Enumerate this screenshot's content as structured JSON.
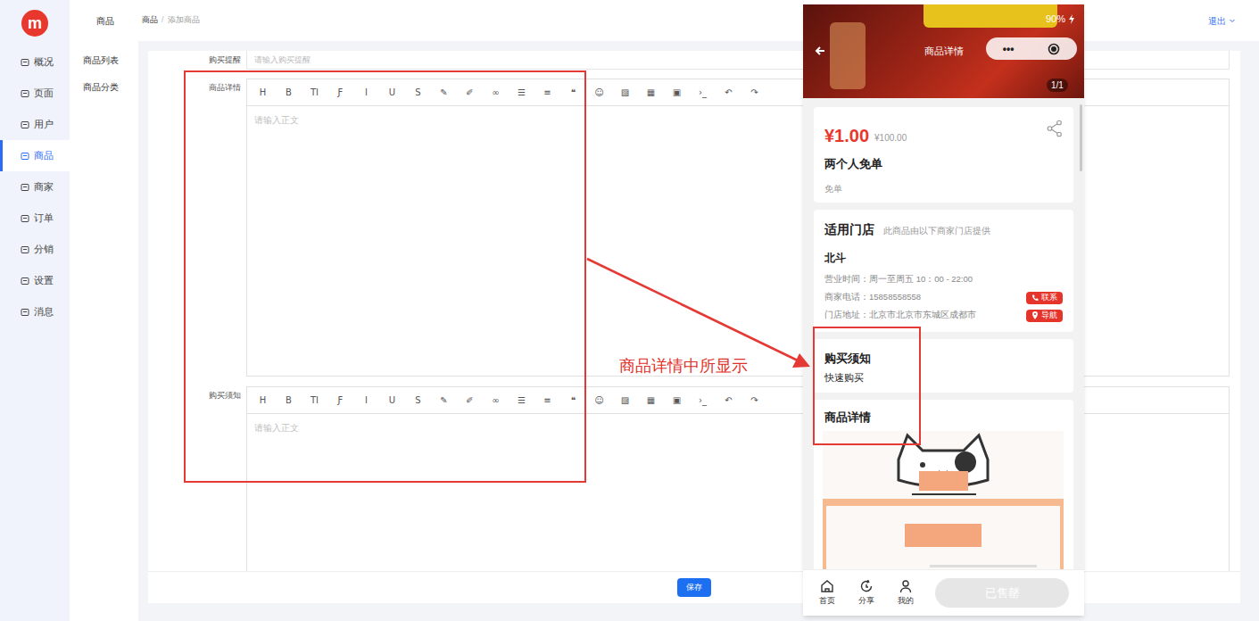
{
  "logo": "m",
  "nav": [
    {
      "label": "概况",
      "selected": false
    },
    {
      "label": "页面",
      "selected": false
    },
    {
      "label": "用户",
      "selected": false
    },
    {
      "label": "商品",
      "selected": true
    },
    {
      "label": "商家",
      "selected": false
    },
    {
      "label": "订单",
      "selected": false
    },
    {
      "label": "分销",
      "selected": false
    },
    {
      "label": "设置",
      "selected": false
    },
    {
      "label": "消息",
      "selected": false
    }
  ],
  "subnav": {
    "title": "商品",
    "items": [
      {
        "label": "商品列表",
        "selected": false
      },
      {
        "label": "商品分类",
        "selected": false
      }
    ]
  },
  "breadcrumb": {
    "items": [
      "商品",
      "添加商品"
    ],
    "separator": "/"
  },
  "logout": "退出",
  "form": {
    "reminder": {
      "label": "购买提醒",
      "placeholder": "请输入购买提醒"
    },
    "toolbar": [
      "H",
      "B",
      "TI",
      "Ƒ",
      "I",
      "U",
      "S",
      "✎",
      "✐",
      "∞",
      "☰",
      "≡",
      "❝",
      "☺",
      "▨",
      "▦",
      "▣",
      "›_",
      "↶",
      "↷"
    ],
    "editors": [
      {
        "label": "商品详情",
        "placeholder": "请输入正文"
      },
      {
        "label": "购买须知",
        "placeholder": "请输入正文"
      }
    ],
    "save": "保存"
  },
  "phone": {
    "status": "90%",
    "title": "商品详情",
    "capsule": "•••",
    "counter": "1/1",
    "price": "¥1.00",
    "original_price": "¥100.00",
    "name": "两个人免单",
    "subtitle": "免单",
    "store": {
      "heading": "适用门店",
      "note": "此商品由以下商家门店提供",
      "name": "北斗",
      "lines": [
        {
          "kind": "hours",
          "text": "营业时间：周一至周五 10：00 - 22:00",
          "button": ""
        },
        {
          "kind": "phone",
          "text": "商家电话：15858558558",
          "button": "联系"
        },
        {
          "kind": "address",
          "text": "门店地址：北京市北京市东城区成都市",
          "button": "导航"
        }
      ]
    },
    "notice": {
      "heading": "购买须知",
      "text": "快速购买"
    },
    "detail": {
      "heading": "商品详情"
    },
    "tabs": [
      {
        "label": "首页",
        "kind": "home"
      },
      {
        "label": "分享",
        "kind": "share"
      },
      {
        "label": "我的",
        "kind": "user"
      }
    ],
    "buy": {
      "label": "已售罄",
      "disabled": true
    }
  },
  "annotation": {
    "caption": "商品详情中所显示"
  }
}
